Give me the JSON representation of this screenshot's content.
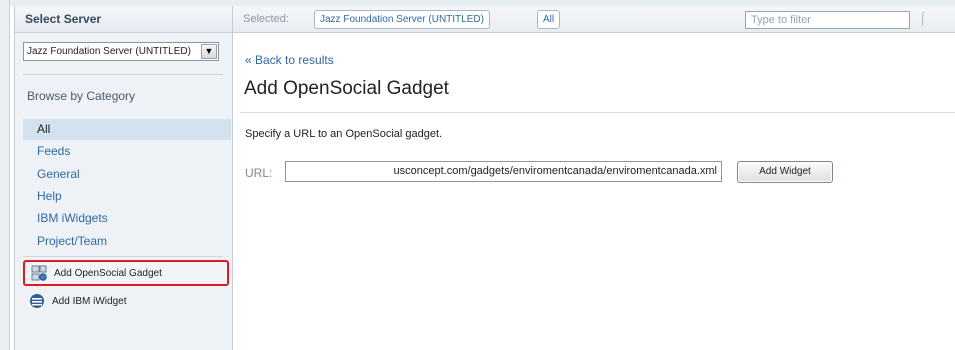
{
  "sidebar": {
    "header": "Select Server",
    "server_value": "Jazz Foundation Server (UNTITLED)",
    "browse_header": "Browse by Category",
    "categories": [
      {
        "label": "All"
      },
      {
        "label": "Feeds"
      },
      {
        "label": "General"
      },
      {
        "label": "Help"
      },
      {
        "label": "IBM iWidgets"
      },
      {
        "label": "Project/Team"
      }
    ],
    "actions": {
      "add_opensocial": "Add OpenSocial Gadget",
      "add_ibm": "Add IBM iWidget"
    }
  },
  "topbar": {
    "selected_label": "Selected:",
    "server_chip": "Jazz Foundation Server (UNTITLED)",
    "all_chip": "All",
    "filter_placeholder": "Type to filter"
  },
  "main": {
    "back_link": "« Back to results",
    "title": "Add OpenSocial Gadget",
    "instruction": "Specify a URL to an OpenSocial gadget.",
    "url_label": "URL:",
    "url_value": "usconcept.com/gadgets/enviromentcanada/enviromentcanada.xml",
    "add_button": "Add Widget"
  },
  "colors": {
    "link": "#2f6aa3",
    "highlight": "#e11b22",
    "selected_bg": "#d4e1ee"
  }
}
